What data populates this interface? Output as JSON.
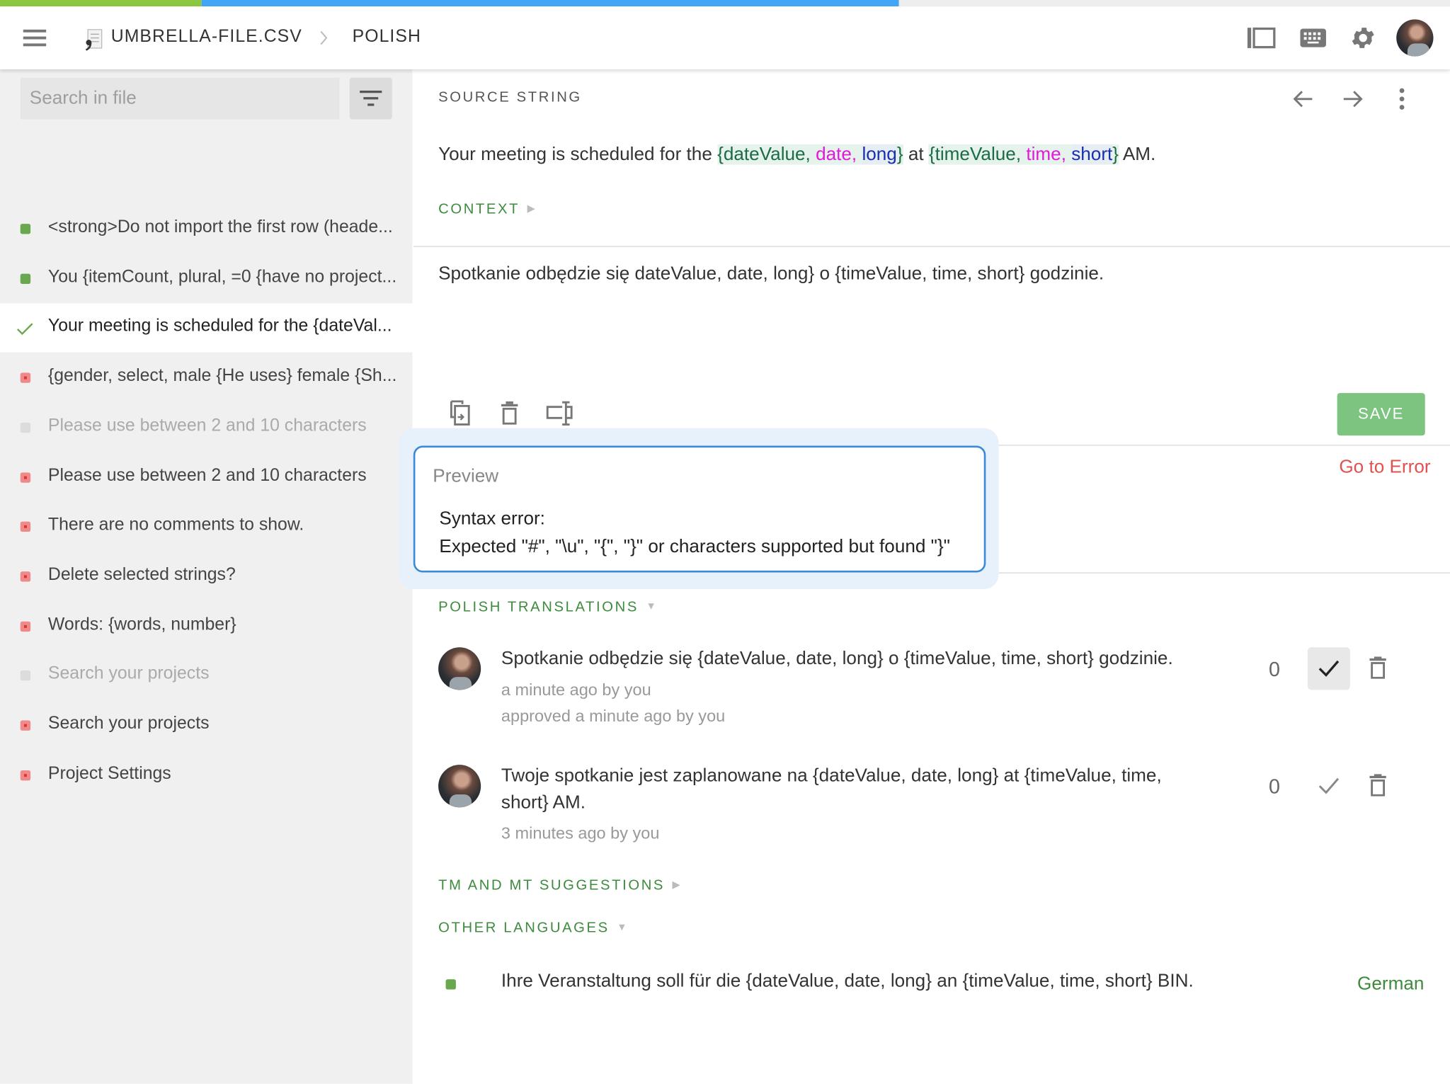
{
  "progress": {
    "approved_percent": 13.9,
    "translated_percent": 62.0,
    "colors": {
      "approved": "#8dc63f",
      "translated": "#42a5f5",
      "empty": "#eeeeee"
    }
  },
  "header": {
    "menu_icon": "hamburger-icon",
    "file_icon": "csv-file-icon",
    "file_name": "UMBRELLA-FILE.CSV",
    "separator_icon": "chevron-right-icon",
    "language": "POLISH",
    "actions": [
      "sidebar-toggle-icon",
      "keyboard-icon",
      "gear-icon",
      "avatar"
    ]
  },
  "sidebar": {
    "search_placeholder": "Search in file",
    "search_value": "",
    "filter_icon": "filter-icon",
    "items": [
      {
        "label": "<strong>Do not import the first row (heade...",
        "status": "green"
      },
      {
        "label": "You {itemCount, plural, =0 {have no project...",
        "status": "green"
      },
      {
        "label": "Your meeting is scheduled for the {dateVal...",
        "status": "check",
        "selected": true
      },
      {
        "label": "{gender, select, male {He uses} female {Sh...",
        "status": "red"
      },
      {
        "label": "Please use between 2 and 10 characters",
        "status": "gray"
      },
      {
        "label": "Please use between 2 and 10 characters",
        "status": "red"
      },
      {
        "label": "There are no comments to show.",
        "status": "red"
      },
      {
        "label": "Delete selected strings?",
        "status": "red"
      },
      {
        "label": "Words: {words, number}",
        "status": "red"
      },
      {
        "label": "Search your projects",
        "status": "gray"
      },
      {
        "label": "Search your projects",
        "status": "red"
      },
      {
        "label": "Project Settings",
        "status": "red"
      }
    ]
  },
  "source": {
    "label": "SOURCE STRING",
    "segments": [
      {
        "text": "Your meeting is scheduled for the ",
        "kind": "plain"
      },
      {
        "text": "{dateValue, ",
        "kind": "ph"
      },
      {
        "text": "date,",
        "kind": "fmt"
      },
      {
        "text": " ",
        "kind": "ph"
      },
      {
        "text": "long",
        "kind": "sty"
      },
      {
        "text": "}",
        "kind": "ph"
      },
      {
        "text": " at ",
        "kind": "plain"
      },
      {
        "text": "{timeValue, ",
        "kind": "ph"
      },
      {
        "text": "time,",
        "kind": "fmt"
      },
      {
        "text": " ",
        "kind": "ph"
      },
      {
        "text": "short",
        "kind": "sty"
      },
      {
        "text": "}",
        "kind": "ph"
      },
      {
        "text": " AM.",
        "kind": "plain"
      }
    ],
    "context_label": "CONTEXT"
  },
  "editor": {
    "value": "Spotkanie odbędzie się dateValue, date, long} o {timeValue, time, short} godzinie.",
    "tools": [
      "copy-source-icon",
      "clear-icon",
      "insert-placeholder-icon"
    ],
    "save_label": "SAVE",
    "go_to_error": "Go to Error"
  },
  "preview": {
    "title": "Preview",
    "error_title": "Syntax error:",
    "error_message": "Expected \"#\", \"\\u\", \"{\", \"}\" or characters supported but found \"}\""
  },
  "translations": {
    "label": "POLISH TRANSLATIONS",
    "items": [
      {
        "text": "Spotkanie odbędzie się {dateValue, date, long} o {timeValue, time, short} godzinie.",
        "meta": "a minute ago by you",
        "approved": "approved a minute ago by you",
        "votes": "0",
        "is_approved": true
      },
      {
        "text": "Twoje spotkanie jest zaplanowane na {dateValue, date, long} at {timeValue, time, short} AM.",
        "meta": "3 minutes ago by you",
        "votes": "0",
        "is_approved": false
      }
    ]
  },
  "suggestions": {
    "label": "TM AND MT SUGGESTIONS"
  },
  "other_languages": {
    "label": "OTHER LANGUAGES",
    "items": [
      {
        "text": "Ihre Veranstaltung soll für die {dateValue, date, long} an {timeValue, time, short} BIN.",
        "language": "German",
        "status": "green"
      }
    ]
  }
}
